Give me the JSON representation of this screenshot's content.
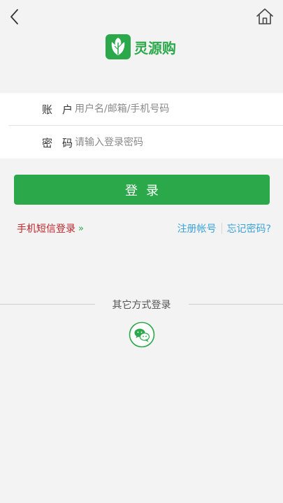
{
  "header": {
    "logo_text": "灵源购"
  },
  "form": {
    "account_label_a": "账",
    "account_label_b": "户",
    "account_placeholder": "用户名/邮箱/手机号码",
    "password_label_a": "密",
    "password_label_b": "码",
    "password_placeholder": "请输入登录密码"
  },
  "actions": {
    "login_label": "登录",
    "sms_login_label": "手机短信登录",
    "sms_chevron": "»",
    "register_label": "注册帐号",
    "forgot_label": "忘记密码?"
  },
  "other": {
    "title": "其它方式登录",
    "wechat_icon": "wechat-icon"
  },
  "colors": {
    "brand_green": "#2ba84a",
    "sms_red": "#c0242a",
    "link_blue": "#3aa3d8"
  }
}
